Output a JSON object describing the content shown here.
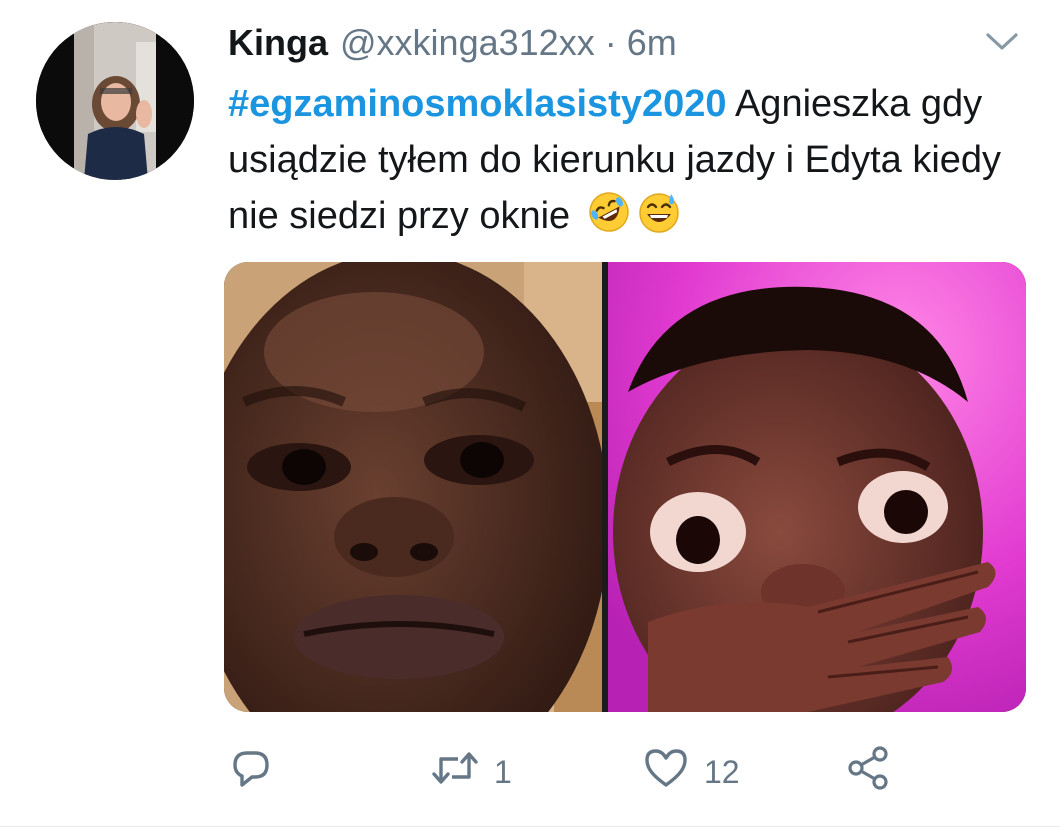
{
  "tweet": {
    "display_name": "Kinga",
    "handle": "@xxkinga312xx",
    "separator": "·",
    "time": "6m",
    "hashtag": "#egzaminosmoklasisty2020",
    "text": " Agnieszka gdy usiądzie tyłem do kierunku jazdy i Edyta kiedy nie siedzi przy oknie",
    "emojis": [
      "rolling-on-floor-laughing-emoji",
      "grinning-sweat-emoji"
    ]
  },
  "actions": {
    "reply": {
      "icon": "reply-icon",
      "count": ""
    },
    "retweet": {
      "icon": "retweet-icon",
      "count": "1"
    },
    "like": {
      "icon": "heart-icon",
      "count": "12"
    },
    "share": {
      "icon": "share-icon",
      "count": ""
    }
  },
  "colors": {
    "hashtag": "#1b95e0",
    "secondary_text": "#657786",
    "icon": "#657786"
  },
  "media": {
    "images": [
      "crying-man-left-photo",
      "crying-man-right-photo"
    ]
  }
}
